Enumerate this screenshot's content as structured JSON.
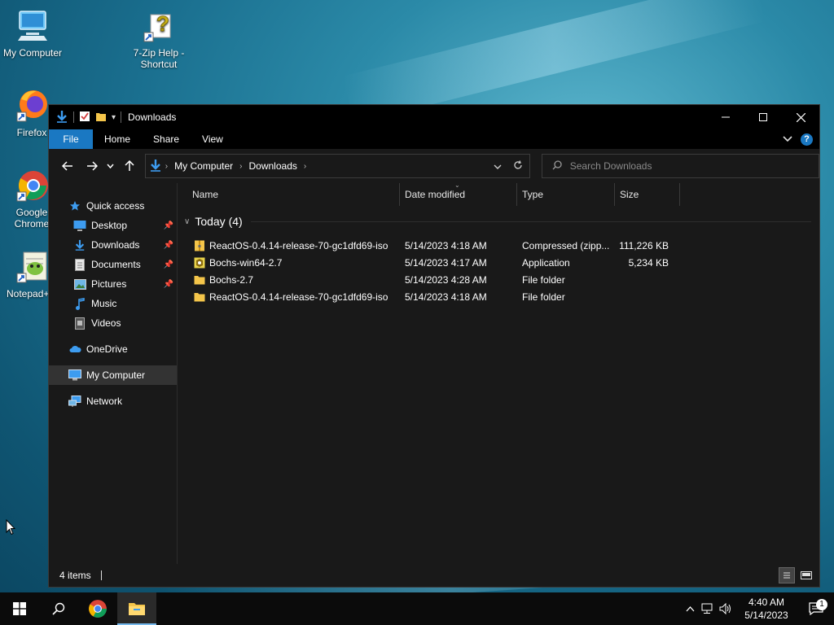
{
  "desktop": {
    "icons": [
      {
        "label": "My Computer"
      },
      {
        "label": "7-Zip Help - Shortcut"
      },
      {
        "label": "Firefox"
      },
      {
        "label": "Google Chrome"
      },
      {
        "label": "Notepad++"
      }
    ]
  },
  "window": {
    "title": "Downloads",
    "ribbon_tabs": {
      "file": "File",
      "home": "Home",
      "share": "Share",
      "view": "View"
    },
    "help_label": "?",
    "breadcrumb": [
      "My Computer",
      "Downloads"
    ],
    "search_placeholder": "Search Downloads",
    "nav": {
      "quick_access": "Quick access",
      "desktop": "Desktop",
      "downloads": "Downloads",
      "documents": "Documents",
      "pictures": "Pictures",
      "music": "Music",
      "videos": "Videos",
      "onedrive": "OneDrive",
      "my_computer": "My Computer",
      "network": "Network"
    },
    "columns": {
      "name": "Name",
      "date": "Date modified",
      "type": "Type",
      "size": "Size"
    },
    "group_label": "Today (4)",
    "files": [
      {
        "name": "ReactOS-0.4.14-release-70-gc1dfd69-iso",
        "date": "5/14/2023 4:18 AM",
        "type": "Compressed (zipp...",
        "size": "111,226 KB",
        "icon": "zip-icon"
      },
      {
        "name": "Bochs-win64-2.7",
        "date": "5/14/2023 4:17 AM",
        "type": "Application",
        "size": "5,234 KB",
        "icon": "app-icon"
      },
      {
        "name": "Bochs-2.7",
        "date": "5/14/2023 4:28 AM",
        "type": "File folder",
        "size": "",
        "icon": "folder-icon"
      },
      {
        "name": "ReactOS-0.4.14-release-70-gc1dfd69-iso",
        "date": "5/14/2023 4:18 AM",
        "type": "File folder",
        "size": "",
        "icon": "folder-icon"
      }
    ],
    "status": "4 items"
  },
  "taskbar": {
    "time": "4:40 AM",
    "date": "5/14/2023",
    "notification_count": "1"
  },
  "colors": {
    "accent": "#1a78c2",
    "window_bg": "#191919",
    "folder": "#f4c54a"
  }
}
